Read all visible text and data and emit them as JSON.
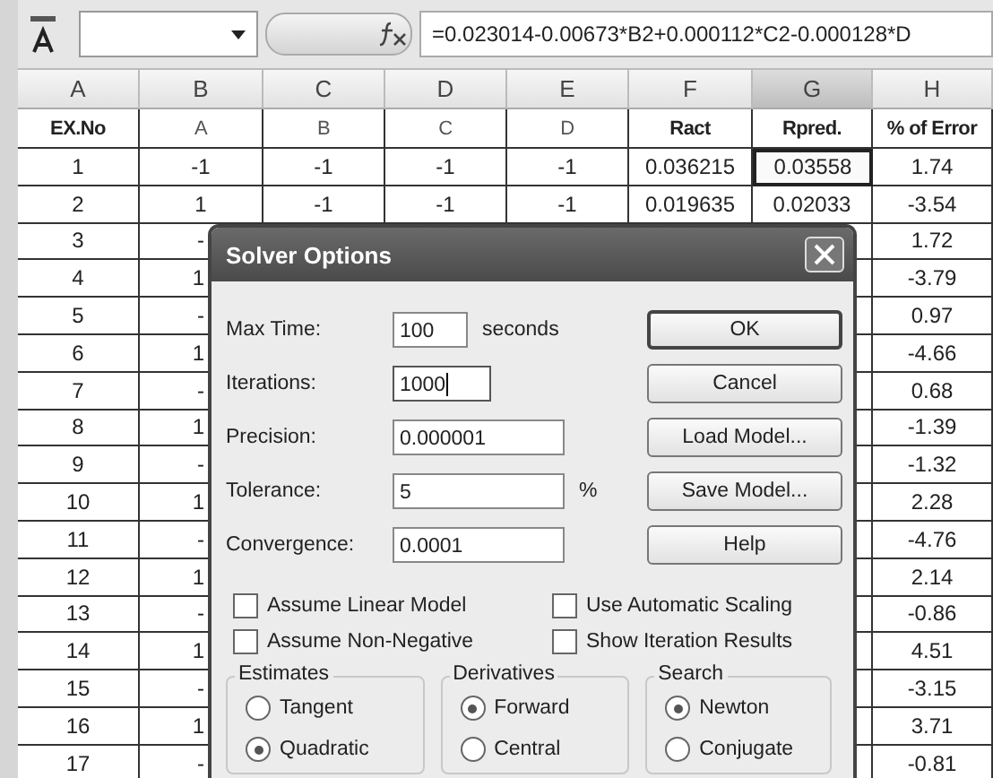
{
  "formula_bar": {
    "formula": "=0.023014-0.00673*B2+0.000112*C2-0.000128*D"
  },
  "columns": [
    {
      "label": "A",
      "selected": false
    },
    {
      "label": "B",
      "selected": false
    },
    {
      "label": "C",
      "selected": false
    },
    {
      "label": "D",
      "selected": false
    },
    {
      "label": "E",
      "selected": false
    },
    {
      "label": "F",
      "selected": false
    },
    {
      "label": "G",
      "selected": true
    },
    {
      "label": "H",
      "selected": false
    }
  ],
  "header_row": [
    "EX.No",
    "A",
    "B",
    "C",
    "D",
    "Ract",
    "Rpred.",
    "% of Error"
  ],
  "rows": [
    {
      "kind": "full",
      "cells": [
        {
          "text": "1",
          "selected": false
        },
        {
          "text": "-1",
          "selected": false
        },
        {
          "text": "-1",
          "selected": false
        },
        {
          "text": "-1",
          "selected": false
        },
        {
          "text": "-1",
          "selected": false
        },
        {
          "text": "0.036215",
          "selected": false
        },
        {
          "text": "0.03558",
          "selected": true
        },
        {
          "text": "1.74",
          "selected": false
        }
      ]
    },
    {
      "kind": "full",
      "cells": [
        {
          "text": "2",
          "selected": false
        },
        {
          "text": "1",
          "selected": false
        },
        {
          "text": "-1",
          "selected": false
        },
        {
          "text": "-1",
          "selected": false
        },
        {
          "text": "-1",
          "selected": false
        },
        {
          "text": "0.019635",
          "selected": false
        },
        {
          "text": "0.02033",
          "selected": false
        },
        {
          "text": "-3.54",
          "selected": false
        }
      ]
    },
    {
      "kind": "covered",
      "ex_no": "3",
      "col_b": "-",
      "error": "1.72"
    },
    {
      "kind": "covered",
      "ex_no": "4",
      "col_b": "1",
      "error": "-3.79"
    },
    {
      "kind": "covered",
      "ex_no": "5",
      "col_b": "-",
      "error": "0.97"
    },
    {
      "kind": "covered",
      "ex_no": "6",
      "col_b": "1",
      "error": "-4.66"
    },
    {
      "kind": "covered",
      "ex_no": "7",
      "col_b": "-",
      "error": "0.68"
    },
    {
      "kind": "covered",
      "ex_no": "8",
      "col_b": "1",
      "error": "-1.39"
    },
    {
      "kind": "covered",
      "ex_no": "9",
      "col_b": "-",
      "error": "-1.32"
    },
    {
      "kind": "covered",
      "ex_no": "10",
      "col_b": "1",
      "error": "2.28"
    },
    {
      "kind": "covered",
      "ex_no": "11",
      "col_b": "-",
      "error": "-4.76"
    },
    {
      "kind": "covered",
      "ex_no": "12",
      "col_b": "1",
      "error": "2.14"
    },
    {
      "kind": "covered",
      "ex_no": "13",
      "col_b": "-",
      "error": "-0.86"
    },
    {
      "kind": "covered",
      "ex_no": "14",
      "col_b": "1",
      "error": "4.51"
    },
    {
      "kind": "covered",
      "ex_no": "15",
      "col_b": "-",
      "error": "-3.15"
    },
    {
      "kind": "covered",
      "ex_no": "16",
      "col_b": "1",
      "error": "3.71"
    },
    {
      "kind": "covered",
      "ex_no": "17",
      "col_b": "-",
      "error": "-0.81"
    }
  ],
  "dialog": {
    "title": "Solver Options",
    "fields": [
      {
        "label": "Max Time:",
        "value": "100",
        "unit": "seconds",
        "focused": false
      },
      {
        "label": "Iterations:",
        "value": "1000",
        "focused": true
      },
      {
        "label": "Precision:",
        "value": "0.000001",
        "focused": false
      },
      {
        "label": "Tolerance:",
        "value": "5",
        "unit": "%",
        "focused": false
      },
      {
        "label": "Convergence:",
        "value": "0.0001",
        "focused": false
      }
    ],
    "buttons": [
      {
        "label": "OK",
        "default": true
      },
      {
        "label": "Cancel",
        "default": false
      },
      {
        "label": "Load Model...",
        "default": false
      },
      {
        "label": "Save Model...",
        "default": false
      },
      {
        "label": "Help",
        "default": false
      }
    ],
    "checkboxes": [
      {
        "label": "Assume Linear Model",
        "checked": false
      },
      {
        "label": "Use Automatic Scaling",
        "checked": false
      },
      {
        "label": "Assume Non-Negative",
        "checked": false
      },
      {
        "label": "Show Iteration Results",
        "checked": false
      }
    ],
    "groups": [
      {
        "title": "Estimates",
        "options": [
          {
            "label": "Tangent",
            "selected": false
          },
          {
            "label": "Quadratic",
            "selected": true
          }
        ]
      },
      {
        "title": "Derivatives",
        "options": [
          {
            "label": "Forward",
            "selected": true
          },
          {
            "label": "Central",
            "selected": false
          }
        ]
      },
      {
        "title": "Search",
        "options": [
          {
            "label": "Newton",
            "selected": true
          },
          {
            "label": "Conjugate",
            "selected": false
          }
        ]
      }
    ]
  }
}
